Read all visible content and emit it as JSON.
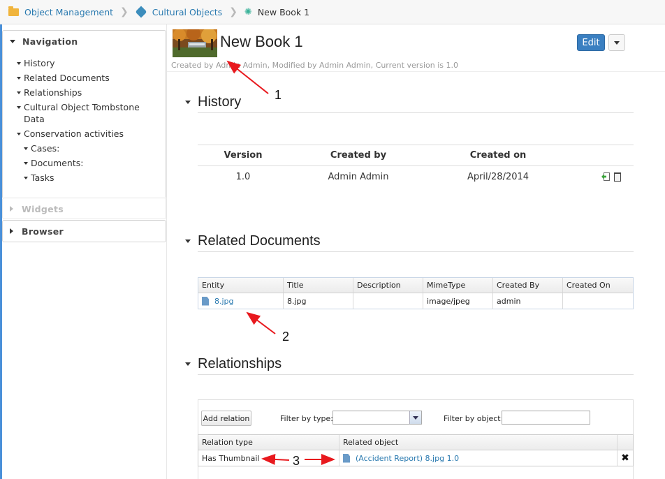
{
  "breadcrumb": {
    "items": [
      {
        "label": "Object Management",
        "icon": "folder-icon"
      },
      {
        "label": "Cultural Objects",
        "icon": "tag-icon"
      },
      {
        "label": "New Book 1",
        "icon": "gear-icon"
      }
    ]
  },
  "sidebar": {
    "navigation": {
      "title": "Navigation",
      "items": [
        {
          "label": "History"
        },
        {
          "label": "Related Documents"
        },
        {
          "label": "Relationships"
        },
        {
          "label": "Cultural Object Tombstone Data"
        },
        {
          "label": "Conservation activities"
        }
      ],
      "subitems": [
        {
          "label": "Cases:"
        },
        {
          "label": "Documents:"
        },
        {
          "label": "Tasks"
        }
      ]
    },
    "widgets": {
      "title": "Widgets"
    },
    "browser": {
      "title": "Browser"
    }
  },
  "document": {
    "title": "New Book 1",
    "meta": "Created by Admin Admin, Modified by Admin Admin, Current version is 1.0",
    "edit_label": "Edit"
  },
  "history": {
    "title": "History",
    "columns": [
      "Version",
      "Created by",
      "Created on"
    ],
    "rows": [
      {
        "version": "1.0",
        "created_by": "Admin Admin",
        "created_on": "April/28/2014"
      }
    ]
  },
  "related_documents": {
    "title": "Related Documents",
    "columns": [
      "Entity",
      "Title",
      "Description",
      "MimeType",
      "Created By",
      "Created On"
    ],
    "rows": [
      {
        "entity": "8.jpg",
        "title": "8.jpg",
        "description": "",
        "mimetype": "image/jpeg",
        "created_by": "admin",
        "created_on": ""
      }
    ]
  },
  "relationships": {
    "title": "Relationships",
    "add_label": "Add relation",
    "filter_type_label": "Filter by type:",
    "filter_type_value": "",
    "filter_object_label": "Filter by object:",
    "filter_object_value": "",
    "columns": [
      "Relation type",
      "Related object"
    ],
    "rows": [
      {
        "type": "Has Thumbnail",
        "object": "(Accident Report) 8.jpg 1.0"
      }
    ]
  },
  "annotations": {
    "label_1": "1",
    "label_2": "2",
    "label_3": "3",
    "arrow_color": "#e8191e"
  },
  "colors": {
    "accent": "#3a7fc1",
    "link": "#2a7ab0",
    "folder": "#f0b43c",
    "gear": "#3bb39a"
  }
}
